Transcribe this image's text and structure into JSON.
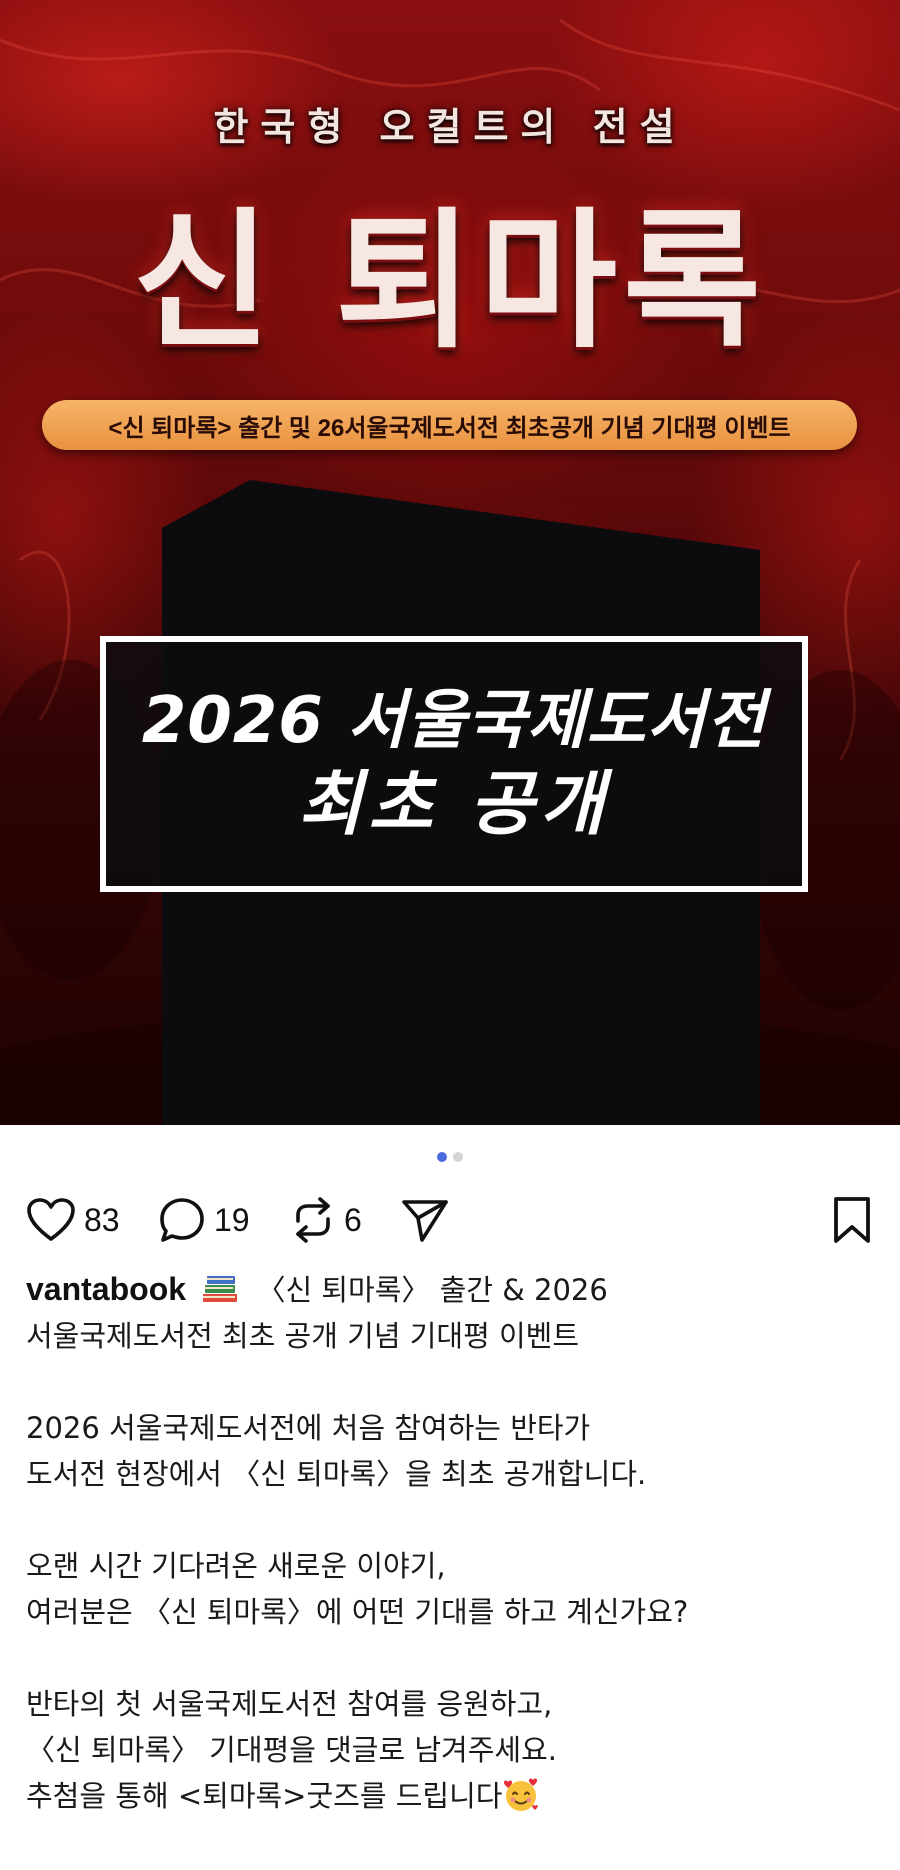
{
  "poster": {
    "tagline": "한국형 오컬트의 전설",
    "title": "신 퇴마록",
    "event_banner": "<신 퇴마록> 출간 및 26서울국제도서전 최초공개 기념 기대평 이벤트",
    "reveal_line1": "2026 서울국제도서전",
    "reveal_line2": "최초 공개"
  },
  "carousel": {
    "total": 2,
    "active": 1
  },
  "actions": {
    "likes": "83",
    "comments": "19",
    "reposts": "6"
  },
  "caption": {
    "username": "vantabook",
    "line1": "〈신 퇴마록〉 출간 & 2026",
    "line2": "서울국제도서전 최초 공개 기념 기대평 이벤트",
    "line3": "2026 서울국제도서전에 처음 참여하는 반타가",
    "line4": "도서전 현장에서 〈신 퇴마록〉을 최초 공개합니다.",
    "line5": "오랜 시간 기다려온 새로운 이야기,",
    "line6": "여러분은 〈신 퇴마록〉에 어떤 기대를 하고 계신가요?",
    "line7": "반타의 첫 서울국제도서전 참여를 응원하고,",
    "line8": "〈신 퇴마록〉 기대평을 댓글로 남겨주세요.",
    "line9": "추첨을 통해 <퇴마록>굿즈를 드립니다"
  },
  "colors": {
    "accent_dot": "#4b6ae0",
    "banner": "#f0a352",
    "poster_red": "#8a0f10"
  },
  "icons": [
    "heart-icon",
    "comment-icon",
    "repost-icon",
    "share-icon",
    "bookmark-icon",
    "books-emoji",
    "smiling-face-with-hearts-emoji"
  ]
}
